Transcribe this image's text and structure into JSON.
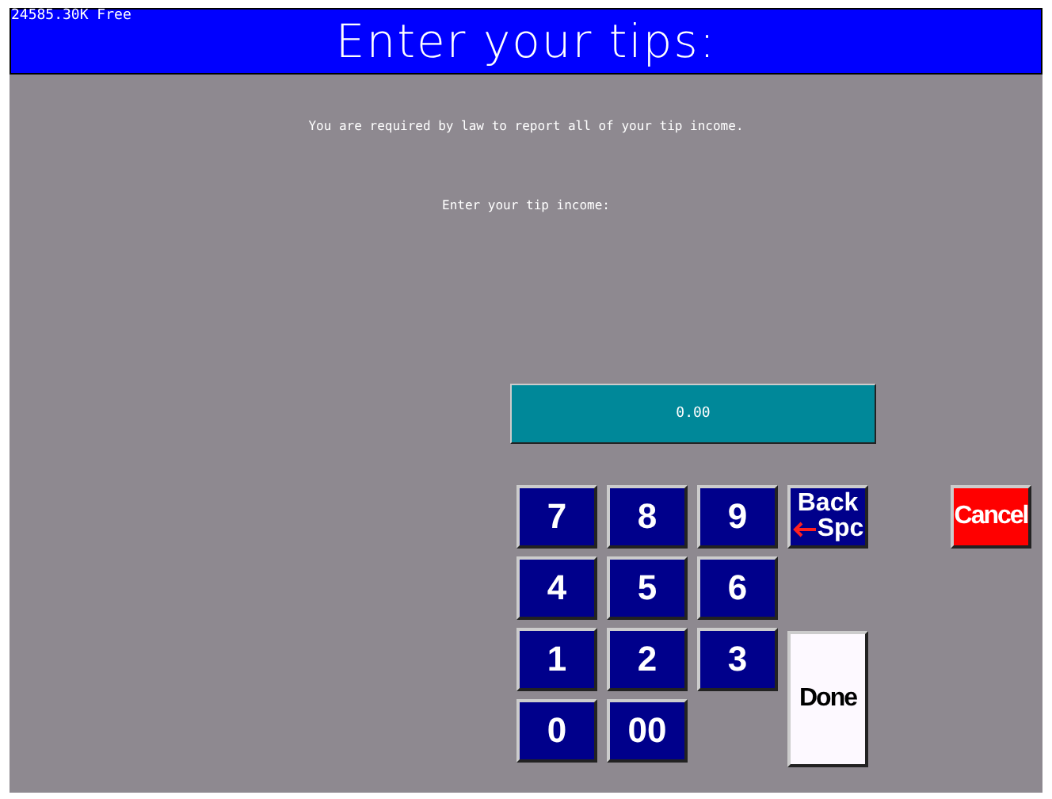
{
  "memory": "24585.30K Free",
  "title": "Enter your tips:",
  "notice": "You are required by law to report all of your tip income.",
  "prompt": "Enter your tip income:",
  "amount": "0.00",
  "keys": [
    {
      "kind": "digit",
      "label": "7"
    },
    {
      "kind": "digit",
      "label": "8"
    },
    {
      "kind": "digit",
      "label": "9"
    },
    {
      "kind": "backspace",
      "label": "Back",
      "sublabel": "Spc"
    },
    {
      "kind": "digit",
      "label": "4"
    },
    {
      "kind": "digit",
      "label": "5"
    },
    {
      "kind": "digit",
      "label": "6"
    },
    {
      "kind": "digit",
      "label": "1"
    },
    {
      "kind": "digit",
      "label": "2"
    },
    {
      "kind": "digit",
      "label": "3"
    },
    {
      "kind": "done",
      "label": "Done"
    },
    {
      "kind": "digit",
      "label": "0"
    },
    {
      "kind": "digit",
      "label": "00"
    }
  ],
  "cancel": "Cancel"
}
